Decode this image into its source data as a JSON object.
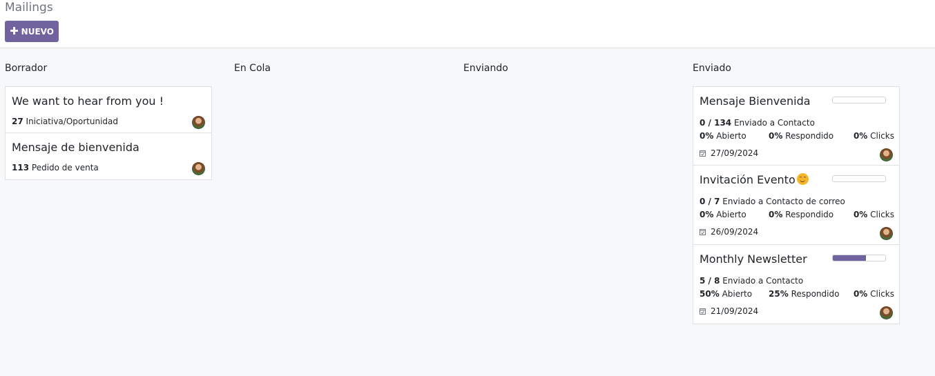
{
  "header": {
    "title": "Mailings",
    "new_button_label": "NUEVO",
    "new_button_icon": "plus-icon"
  },
  "colors": {
    "accent": "#71639e",
    "background": "#f7f8fa"
  },
  "columns": [
    {
      "title": "Borrador",
      "cards": [
        {
          "title": "We want to hear from you !",
          "count": "27",
          "model": "Iniciativa/Oportunidad"
        },
        {
          "title": "Mensaje de bienvenida",
          "count": "113",
          "model": "Pedido de venta"
        }
      ]
    },
    {
      "title": "En Cola",
      "cards": []
    },
    {
      "title": "Enviando",
      "cards": []
    },
    {
      "title": "Enviado",
      "cards": [
        {
          "title": "Mensaje Bienvenida",
          "progress_percent": 0,
          "sent": "0 / 134",
          "sent_label": "Enviado a Contacto",
          "opened": "0%",
          "opened_label": "Abierto",
          "replied": "0%",
          "replied_label": "Respondido",
          "clicks": "0%",
          "clicks_label": "Clicks",
          "date": "27/09/2024"
        },
        {
          "title": "Invitación Evento",
          "title_emoji": "smiling-face-icon",
          "progress_percent": 0,
          "sent": "0 / 7",
          "sent_label": "Enviado a Contacto de correo",
          "opened": "0%",
          "opened_label": "Abierto",
          "replied": "0%",
          "replied_label": "Respondido",
          "clicks": "0%",
          "clicks_label": "Clicks",
          "date": "26/09/2024"
        },
        {
          "title": "Monthly Newsletter",
          "progress_percent": 62.5,
          "sent": "5 / 8",
          "sent_label": "Enviado a Contacto",
          "opened": "50%",
          "opened_label": "Abierto",
          "replied": "25%",
          "replied_label": "Respondido",
          "clicks": "0%",
          "clicks_label": "Clicks",
          "date": "21/09/2024"
        }
      ]
    }
  ]
}
